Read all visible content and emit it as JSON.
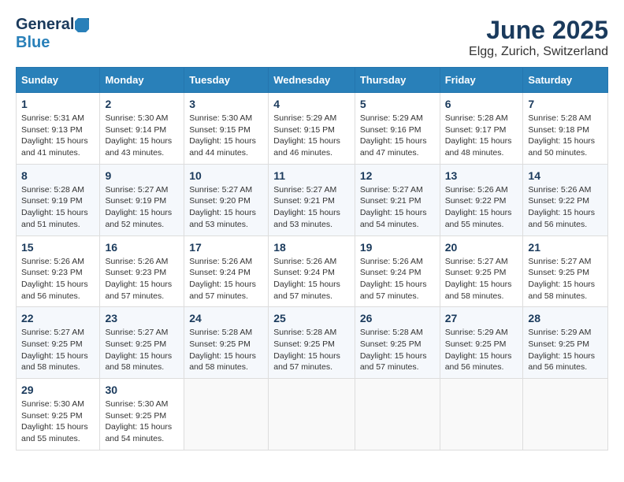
{
  "header": {
    "logo_general": "General",
    "logo_blue": "Blue",
    "month_title": "June 2025",
    "location": "Elgg, Zurich, Switzerland"
  },
  "calendar": {
    "weekdays": [
      "Sunday",
      "Monday",
      "Tuesday",
      "Wednesday",
      "Thursday",
      "Friday",
      "Saturday"
    ],
    "weeks": [
      [
        {
          "day": "",
          "info": ""
        },
        {
          "day": "2",
          "info": "Sunrise: 5:30 AM\nSunset: 9:14 PM\nDaylight: 15 hours\nand 43 minutes."
        },
        {
          "day": "3",
          "info": "Sunrise: 5:30 AM\nSunset: 9:15 PM\nDaylight: 15 hours\nand 44 minutes."
        },
        {
          "day": "4",
          "info": "Sunrise: 5:29 AM\nSunset: 9:15 PM\nDaylight: 15 hours\nand 46 minutes."
        },
        {
          "day": "5",
          "info": "Sunrise: 5:29 AM\nSunset: 9:16 PM\nDaylight: 15 hours\nand 47 minutes."
        },
        {
          "day": "6",
          "info": "Sunrise: 5:28 AM\nSunset: 9:17 PM\nDaylight: 15 hours\nand 48 minutes."
        },
        {
          "day": "7",
          "info": "Sunrise: 5:28 AM\nSunset: 9:18 PM\nDaylight: 15 hours\nand 50 minutes."
        }
      ],
      [
        {
          "day": "8",
          "info": "Sunrise: 5:28 AM\nSunset: 9:19 PM\nDaylight: 15 hours\nand 51 minutes."
        },
        {
          "day": "9",
          "info": "Sunrise: 5:27 AM\nSunset: 9:19 PM\nDaylight: 15 hours\nand 52 minutes."
        },
        {
          "day": "10",
          "info": "Sunrise: 5:27 AM\nSunset: 9:20 PM\nDaylight: 15 hours\nand 53 minutes."
        },
        {
          "day": "11",
          "info": "Sunrise: 5:27 AM\nSunset: 9:21 PM\nDaylight: 15 hours\nand 53 minutes."
        },
        {
          "day": "12",
          "info": "Sunrise: 5:27 AM\nSunset: 9:21 PM\nDaylight: 15 hours\nand 54 minutes."
        },
        {
          "day": "13",
          "info": "Sunrise: 5:26 AM\nSunset: 9:22 PM\nDaylight: 15 hours\nand 55 minutes."
        },
        {
          "day": "14",
          "info": "Sunrise: 5:26 AM\nSunset: 9:22 PM\nDaylight: 15 hours\nand 56 minutes."
        }
      ],
      [
        {
          "day": "15",
          "info": "Sunrise: 5:26 AM\nSunset: 9:23 PM\nDaylight: 15 hours\nand 56 minutes."
        },
        {
          "day": "16",
          "info": "Sunrise: 5:26 AM\nSunset: 9:23 PM\nDaylight: 15 hours\nand 57 minutes."
        },
        {
          "day": "17",
          "info": "Sunrise: 5:26 AM\nSunset: 9:24 PM\nDaylight: 15 hours\nand 57 minutes."
        },
        {
          "day": "18",
          "info": "Sunrise: 5:26 AM\nSunset: 9:24 PM\nDaylight: 15 hours\nand 57 minutes."
        },
        {
          "day": "19",
          "info": "Sunrise: 5:26 AM\nSunset: 9:24 PM\nDaylight: 15 hours\nand 57 minutes."
        },
        {
          "day": "20",
          "info": "Sunrise: 5:27 AM\nSunset: 9:25 PM\nDaylight: 15 hours\nand 58 minutes."
        },
        {
          "day": "21",
          "info": "Sunrise: 5:27 AM\nSunset: 9:25 PM\nDaylight: 15 hours\nand 58 minutes."
        }
      ],
      [
        {
          "day": "22",
          "info": "Sunrise: 5:27 AM\nSunset: 9:25 PM\nDaylight: 15 hours\nand 58 minutes."
        },
        {
          "day": "23",
          "info": "Sunrise: 5:27 AM\nSunset: 9:25 PM\nDaylight: 15 hours\nand 58 minutes."
        },
        {
          "day": "24",
          "info": "Sunrise: 5:28 AM\nSunset: 9:25 PM\nDaylight: 15 hours\nand 58 minutes."
        },
        {
          "day": "25",
          "info": "Sunrise: 5:28 AM\nSunset: 9:25 PM\nDaylight: 15 hours\nand 57 minutes."
        },
        {
          "day": "26",
          "info": "Sunrise: 5:28 AM\nSunset: 9:25 PM\nDaylight: 15 hours\nand 57 minutes."
        },
        {
          "day": "27",
          "info": "Sunrise: 5:29 AM\nSunset: 9:25 PM\nDaylight: 15 hours\nand 56 minutes."
        },
        {
          "day": "28",
          "info": "Sunrise: 5:29 AM\nSunset: 9:25 PM\nDaylight: 15 hours\nand 56 minutes."
        }
      ],
      [
        {
          "day": "29",
          "info": "Sunrise: 5:30 AM\nSunset: 9:25 PM\nDaylight: 15 hours\nand 55 minutes."
        },
        {
          "day": "30",
          "info": "Sunrise: 5:30 AM\nSunset: 9:25 PM\nDaylight: 15 hours\nand 54 minutes."
        },
        {
          "day": "",
          "info": ""
        },
        {
          "day": "",
          "info": ""
        },
        {
          "day": "",
          "info": ""
        },
        {
          "day": "",
          "info": ""
        },
        {
          "day": "",
          "info": ""
        }
      ]
    ],
    "first_week": [
      {
        "day": "1",
        "info": "Sunrise: 5:31 AM\nSunset: 9:13 PM\nDaylight: 15 hours\nand 41 minutes."
      }
    ]
  }
}
